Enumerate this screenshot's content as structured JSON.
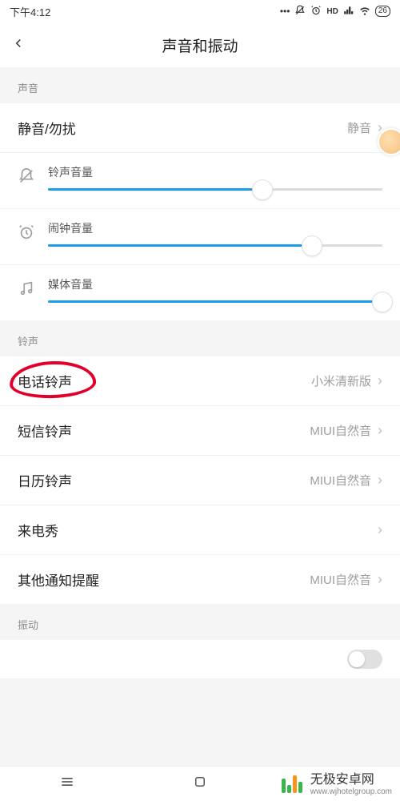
{
  "status": {
    "time": "下午4:12",
    "battery": "26"
  },
  "header": {
    "title": "声音和振动"
  },
  "sections": {
    "sound": "声音",
    "ringtone": "铃声",
    "vibration": "振动"
  },
  "silent": {
    "label": "静音/勿扰",
    "value": "静音"
  },
  "sliders": {
    "ringer": {
      "label": "铃声音量",
      "percent": 64
    },
    "alarm": {
      "label": "闹钟音量",
      "percent": 79
    },
    "media": {
      "label": "媒体音量",
      "percent": 100
    }
  },
  "ringtones": {
    "phone": {
      "label": "电话铃声",
      "value": "小米清新版"
    },
    "sms": {
      "label": "短信铃声",
      "value": "MIUI自然音"
    },
    "calendar": {
      "label": "日历铃声",
      "value": "MIUI自然音"
    },
    "caller_show": {
      "label": "来电秀",
      "value": ""
    },
    "other": {
      "label": "其他通知提醒",
      "value": "MIUI自然音"
    }
  },
  "watermark": {
    "brand": "无极安卓网",
    "url": "www.wjhotelgroup.com"
  }
}
